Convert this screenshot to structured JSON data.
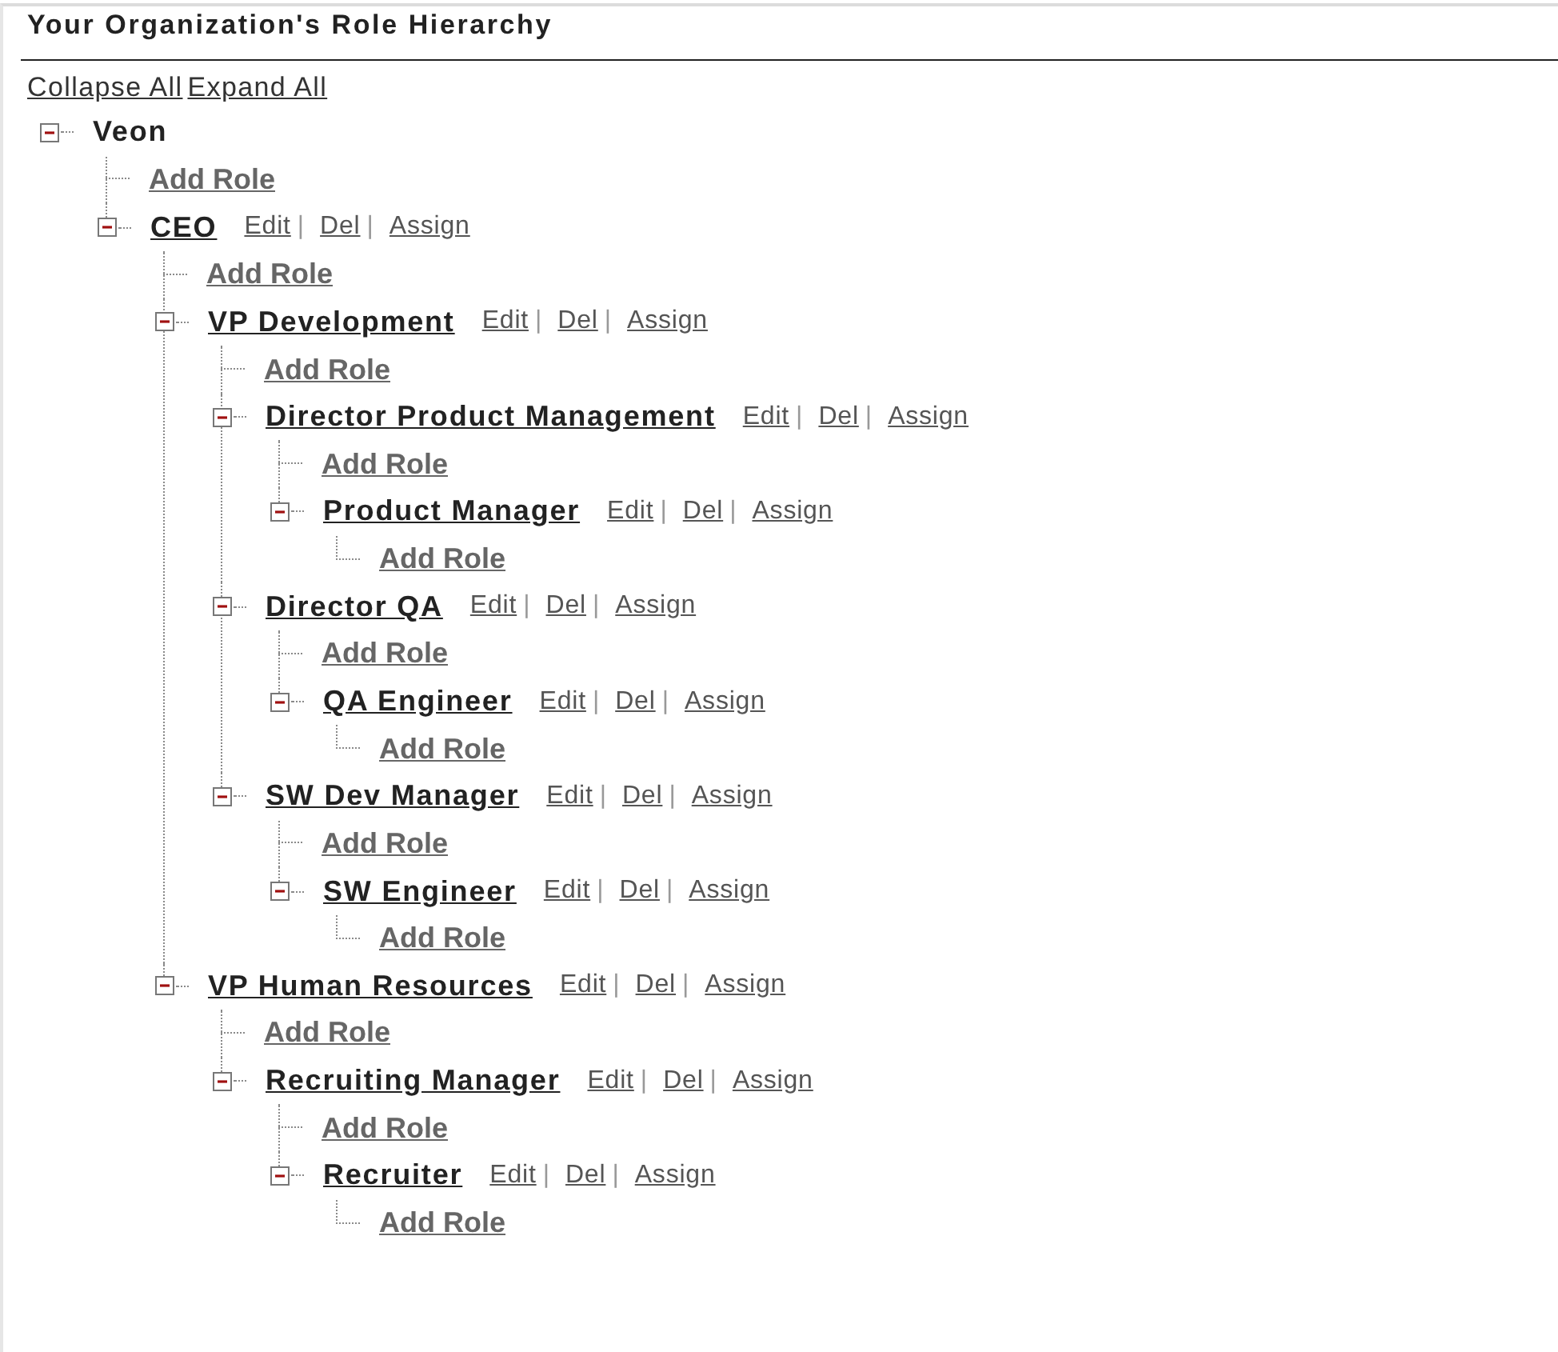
{
  "header": {
    "title": "Your Organization's Role Hierarchy"
  },
  "toolbar": {
    "links": [
      "Collapse All",
      "Expand All"
    ]
  },
  "tree": [
    {
      "kind": "root",
      "name": "Veon",
      "expanded": true,
      "children": [
        {
          "kind": "add",
          "label": "Add Role"
        },
        {
          "kind": "role",
          "name": "CEO",
          "expanded": true,
          "actions": [
            {
              "label": "Edit",
              "separator": "|"
            },
            {
              "label": "Del",
              "separator": "|"
            },
            {
              "label": "Assign"
            }
          ],
          "children": [
            {
              "kind": "add",
              "label": "Add Role"
            },
            {
              "kind": "role",
              "name": "VP Development",
              "expanded": true,
              "actions": [
                {
                  "label": "Edit",
                  "separator": "|"
                },
                {
                  "label": "Del",
                  "separator": "|"
                },
                {
                  "label": "Assign"
                }
              ],
              "children": [
                {
                  "kind": "add",
                  "label": "Add Role"
                },
                {
                  "kind": "role",
                  "name": "Director Product Management",
                  "expanded": true,
                  "actions": [
                    {
                      "label": "Edit",
                      "separator": "|"
                    },
                    {
                      "label": "Del",
                      "separator": "|"
                    },
                    {
                      "label": "Assign"
                    }
                  ],
                  "children": [
                    {
                      "kind": "add",
                      "label": "Add Role"
                    },
                    {
                      "kind": "role",
                      "name": "Product Manager",
                      "expanded": true,
                      "actions": [
                        {
                          "label": "Edit",
                          "separator": "|"
                        },
                        {
                          "label": "Del",
                          "separator": "|"
                        },
                        {
                          "label": "Assign"
                        }
                      ],
                      "children": [
                        {
                          "kind": "add",
                          "label": "Add Role"
                        }
                      ]
                    }
                  ]
                },
                {
                  "kind": "role",
                  "name": "Director QA",
                  "expanded": true,
                  "actions": [
                    {
                      "label": "Edit",
                      "separator": "|"
                    },
                    {
                      "label": "Del",
                      "separator": "|"
                    },
                    {
                      "label": "Assign"
                    }
                  ],
                  "children": [
                    {
                      "kind": "add",
                      "label": "Add Role"
                    },
                    {
                      "kind": "role",
                      "name": "QA Engineer",
                      "expanded": true,
                      "actions": [
                        {
                          "label": "Edit",
                          "separator": "|"
                        },
                        {
                          "label": "Del",
                          "separator": "|"
                        },
                        {
                          "label": "Assign"
                        }
                      ],
                      "children": [
                        {
                          "kind": "add",
                          "label": "Add Role"
                        }
                      ]
                    }
                  ]
                },
                {
                  "kind": "role",
                  "name": "SW Dev Manager",
                  "expanded": true,
                  "actions": [
                    {
                      "label": "Edit",
                      "separator": "|"
                    },
                    {
                      "label": "Del",
                      "separator": "|"
                    },
                    {
                      "label": "Assign"
                    }
                  ],
                  "children": [
                    {
                      "kind": "add",
                      "label": "Add Role"
                    },
                    {
                      "kind": "role",
                      "name": "SW Engineer",
                      "expanded": true,
                      "actions": [
                        {
                          "label": "Edit",
                          "separator": "|"
                        },
                        {
                          "label": "Del",
                          "separator": "|"
                        },
                        {
                          "label": "Assign"
                        }
                      ],
                      "children": [
                        {
                          "kind": "add",
                          "label": "Add Role"
                        }
                      ]
                    }
                  ]
                }
              ]
            },
            {
              "kind": "role",
              "name": "VP Human Resources",
              "expanded": true,
              "actions": [
                {
                  "label": "Edit",
                  "separator": "|"
                },
                {
                  "label": "Del",
                  "separator": "|"
                },
                {
                  "label": "Assign"
                }
              ],
              "children": [
                {
                  "kind": "add",
                  "label": "Add Role"
                },
                {
                  "kind": "role",
                  "name": "Recruiting Manager",
                  "expanded": true,
                  "actions": [
                    {
                      "label": "Edit",
                      "separator": "|"
                    },
                    {
                      "label": "Del",
                      "separator": "|"
                    },
                    {
                      "label": "Assign"
                    }
                  ],
                  "children": [
                    {
                      "kind": "add",
                      "label": "Add Role"
                    },
                    {
                      "kind": "role",
                      "name": "Recruiter",
                      "expanded": true,
                      "actions": [
                        {
                          "label": "Edit",
                          "separator": "|"
                        },
                        {
                          "label": "Del",
                          "separator": "|"
                        },
                        {
                          "label": "Assign"
                        }
                      ],
                      "children": [
                        {
                          "kind": "add",
                          "label": "Add Role"
                        }
                      ]
                    }
                  ]
                }
              ]
            }
          ]
        }
      ]
    }
  ]
}
